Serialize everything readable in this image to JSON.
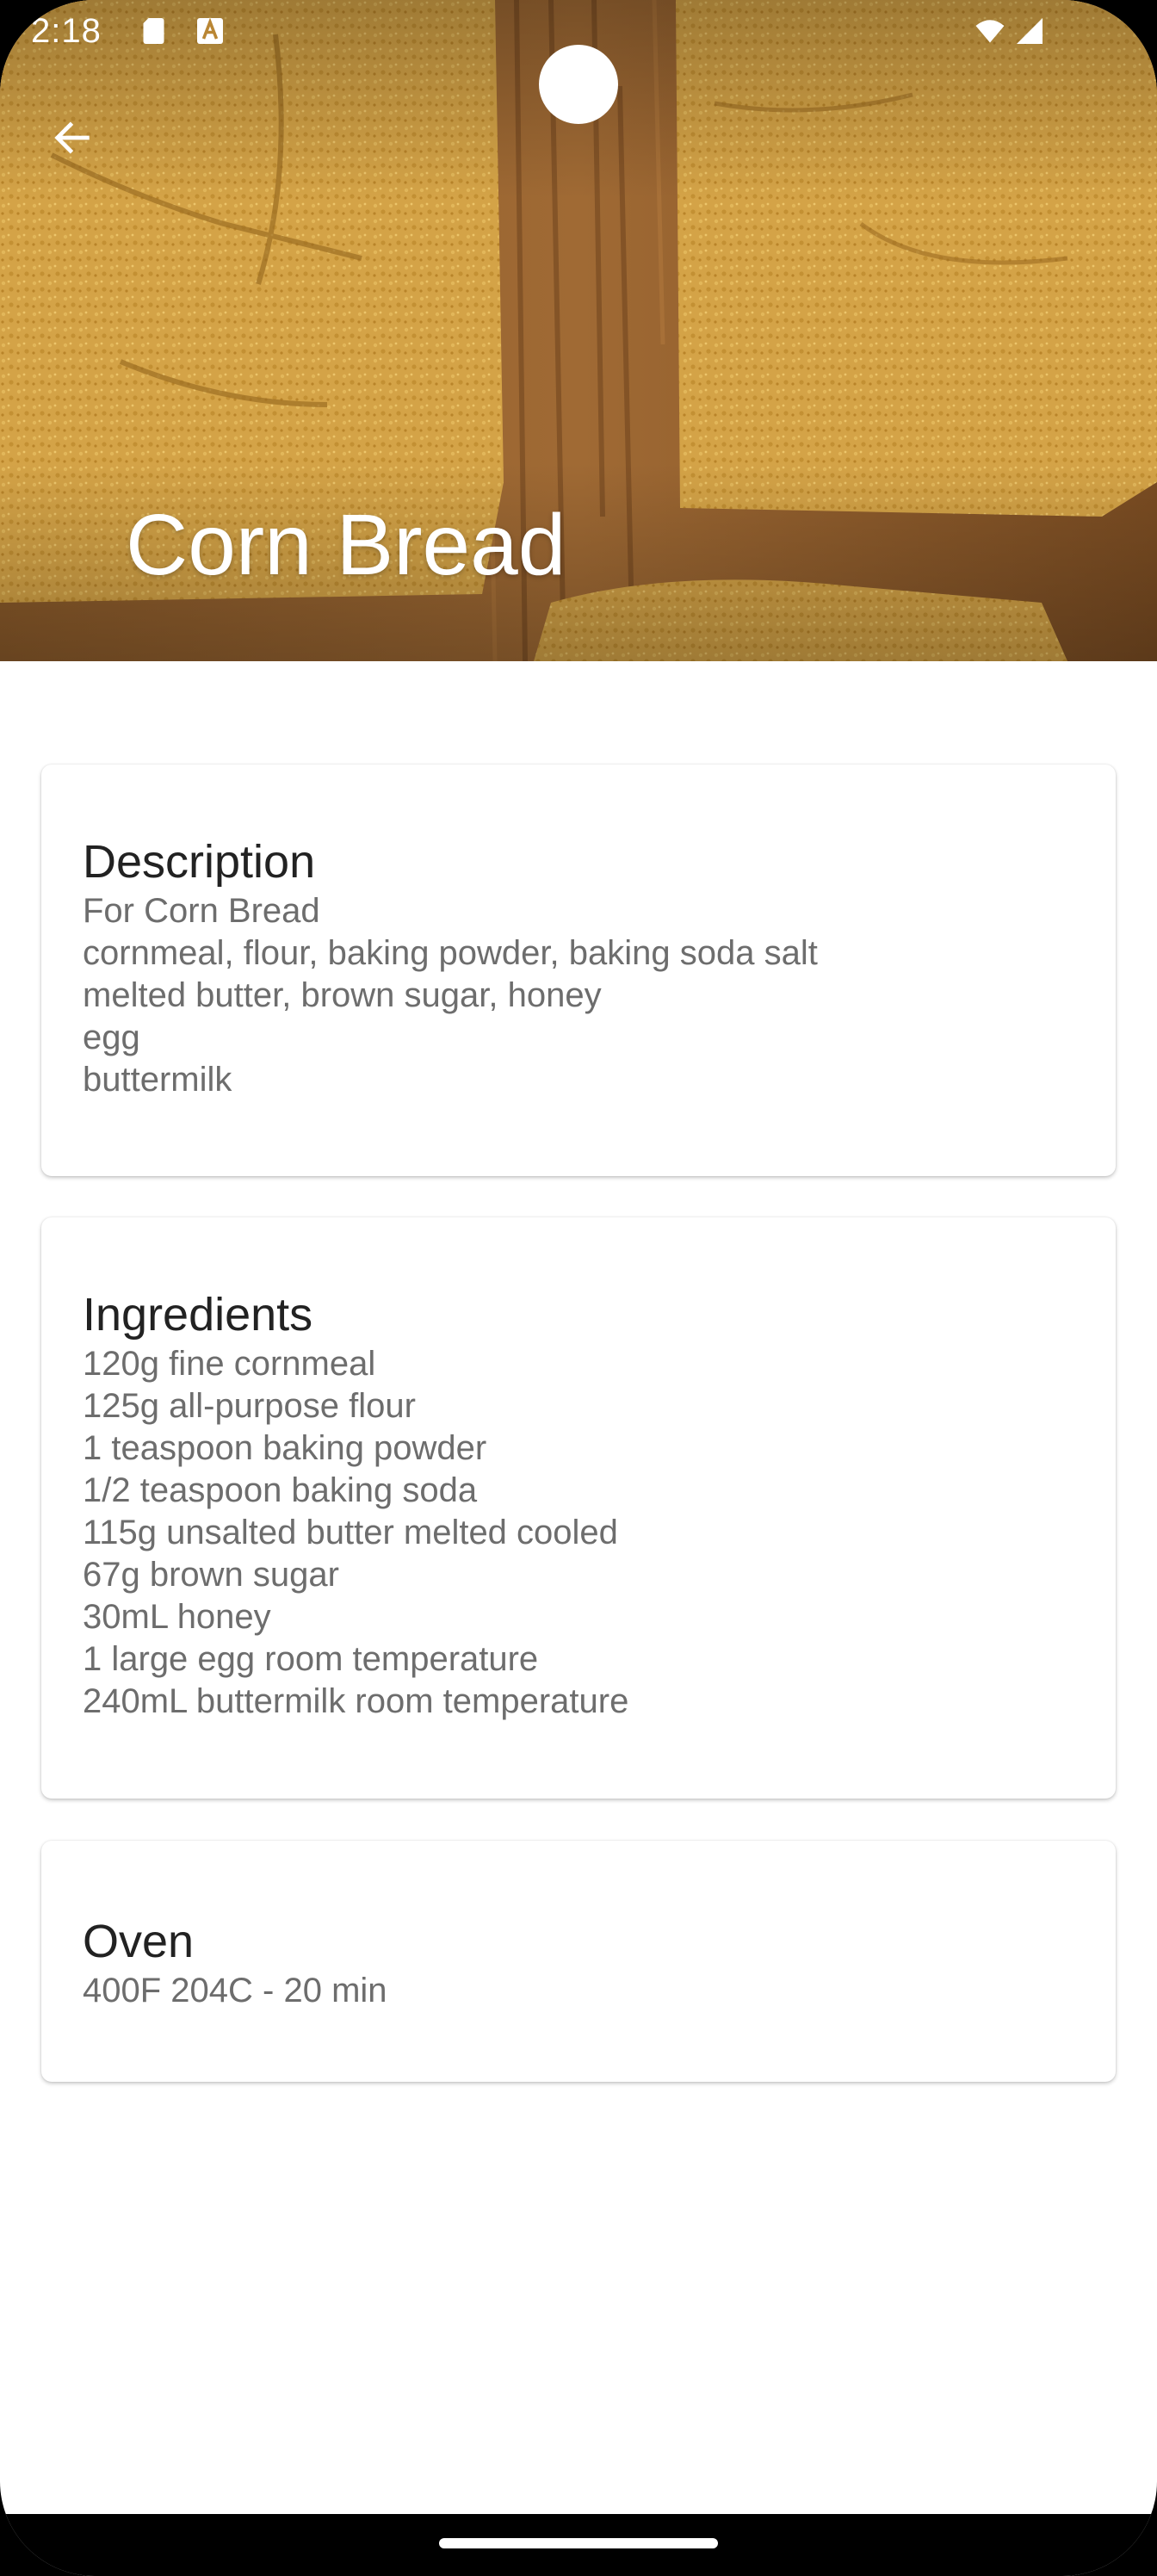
{
  "status_bar": {
    "time": "2:18",
    "left_icons": [
      "sd-card-icon",
      "a-notification-icon"
    ],
    "right_icons": [
      "wifi-icon",
      "cell-signal-icon"
    ]
  },
  "header": {
    "back_icon": "arrow-left-icon",
    "title": "Corn Bread"
  },
  "sections": {
    "description": {
      "title": "Description",
      "lines": [
        "For Corn Bread",
        "cornmeal, flour, baking powder, baking soda salt",
        "melted butter, brown sugar, honey",
        "egg",
        "buttermilk"
      ]
    },
    "ingredients": {
      "title": "Ingredients",
      "lines": [
        "120g fine cornmeal",
        "125g all-purpose flour",
        "1 teaspoon baking powder",
        "1/2 teaspoon baking soda",
        "115g unsalted butter melted cooled",
        "67g brown sugar",
        "30mL honey",
        "1 large egg room temperature",
        "240mL buttermilk room temperature"
      ]
    },
    "oven": {
      "title": "Oven",
      "lines": [
        "400F 204C - 20 min"
      ]
    }
  },
  "colors": {
    "background": "#ffffff",
    "title_text": "#222222",
    "body_text": "#6d6d6d",
    "hero_overlay_text": "#ffffff",
    "nav_bar": "#000000"
  }
}
